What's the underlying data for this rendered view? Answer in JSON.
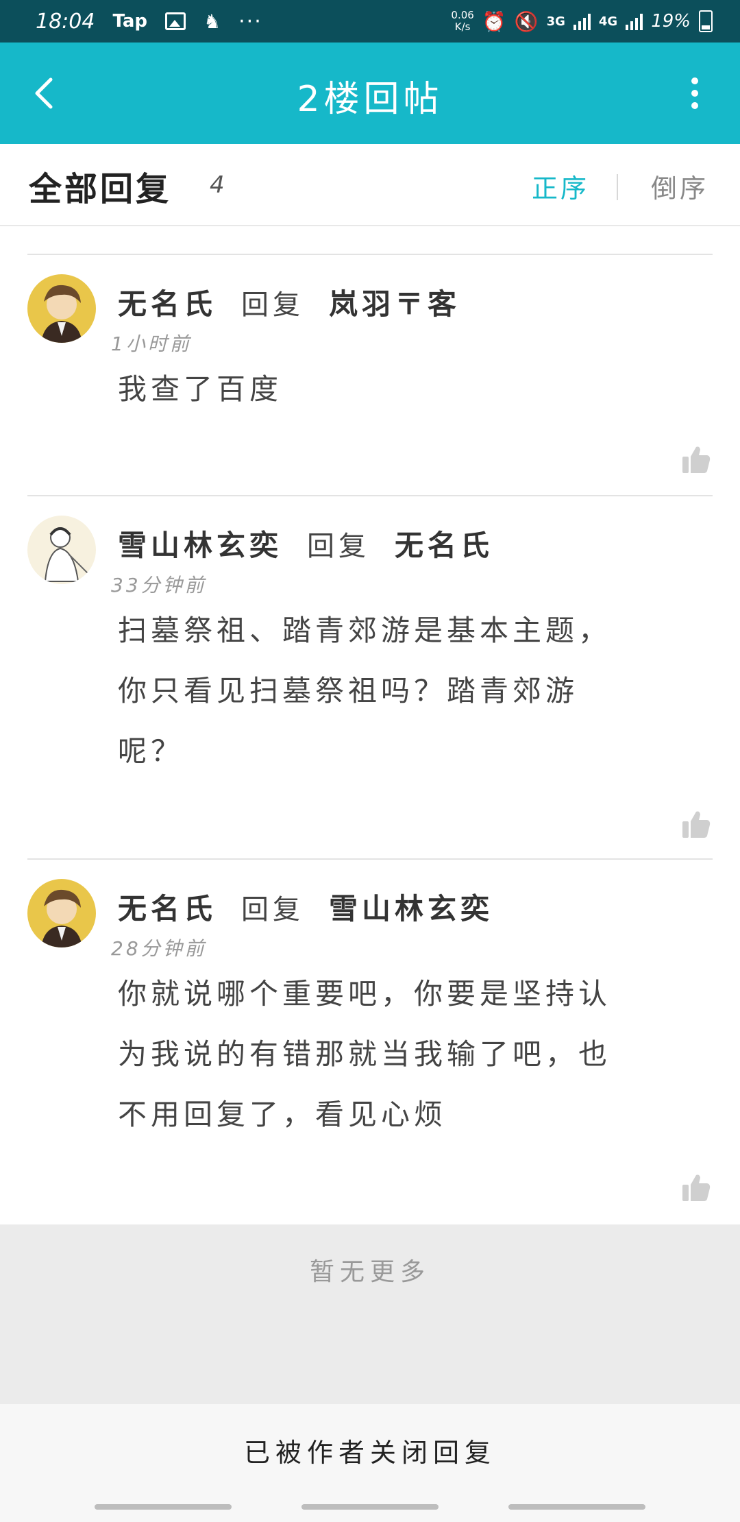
{
  "status_bar": {
    "time": "18:04",
    "app_label": "Tap",
    "dots": "···",
    "net_speed_top": "0.06",
    "net_speed_bottom": "K/s",
    "net_3g": "3G",
    "net_4g": "4G",
    "battery": "19%"
  },
  "title_bar": {
    "title": "2楼回帖"
  },
  "replies_header": {
    "title": "全部回复",
    "count": "4",
    "sort_asc": "正序",
    "sort_desc": "倒序"
  },
  "replies": [
    {
      "user": "无名氏",
      "verb": "回复",
      "target": "岚羽〒客",
      "time": "1小时前",
      "lines": [
        "我查了百度"
      ]
    },
    {
      "user": "雪山林玄奕",
      "verb": "回复",
      "target": "无名氏",
      "time": "33分钟前",
      "lines": [
        "扫墓祭祖、踏青郊游是基本主题，",
        "你只看见扫墓祭祖吗？踏青郊游",
        "呢？"
      ]
    },
    {
      "user": "无名氏",
      "verb": "回复",
      "target": "雪山林玄奕",
      "time": "28分钟前",
      "lines": [
        "你就说哪个重要吧，你要是坚持认",
        "为我说的有错那就当我输了吧，也",
        "不用回复了，看见心烦"
      ]
    }
  ],
  "footer": {
    "no_more": "暂无更多",
    "closed_notice": "已被作者关闭回复"
  },
  "colors": {
    "status_bar_bg": "#0c4f5b",
    "title_bar_bg": "#16b8c9",
    "accent": "#16b8c9"
  }
}
